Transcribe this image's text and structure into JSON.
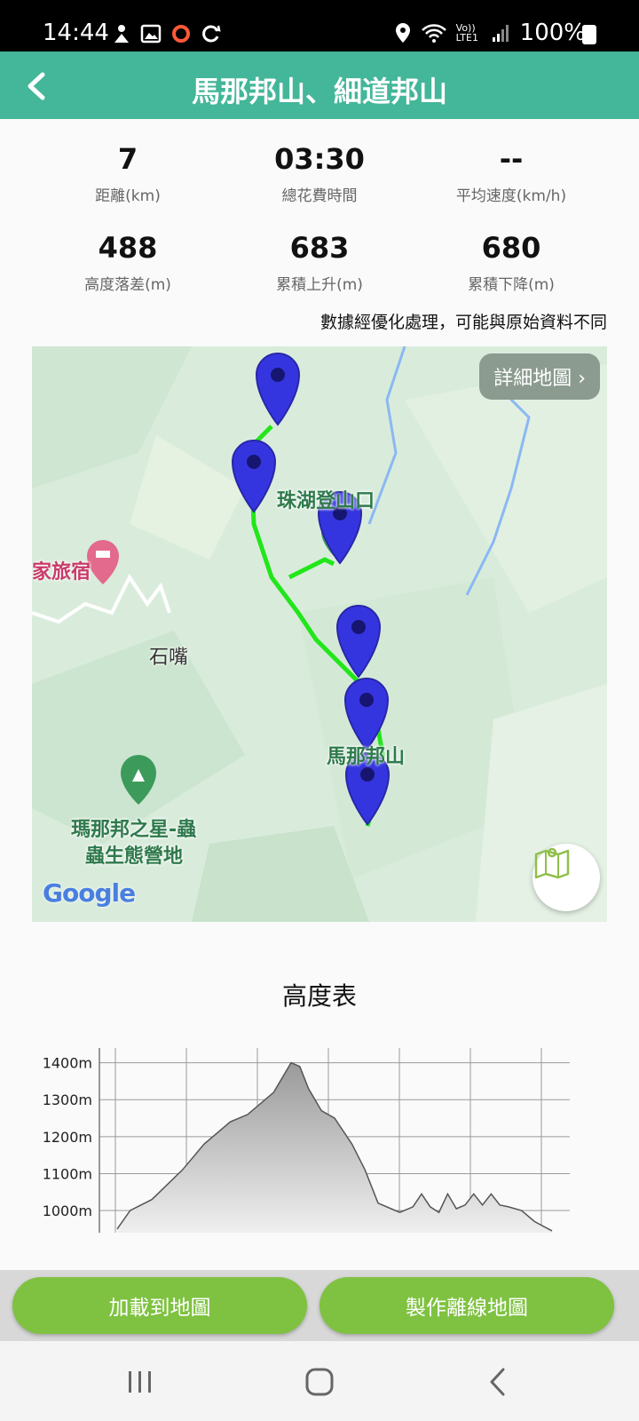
{
  "status_bar": {
    "time": "14:44",
    "network": "Vo)) LTE1",
    "battery": "100%"
  },
  "app_bar": {
    "title": "馬那邦山、細道邦山",
    "back_icon": "back-chevron-icon"
  },
  "stats": [
    {
      "value": "7",
      "label": "距離(km)"
    },
    {
      "value": "03:30",
      "label": "總花費時間"
    },
    {
      "value": "--",
      "label": "平均速度(km/h)"
    },
    {
      "value": "488",
      "label": "高度落差(m)"
    },
    {
      "value": "683",
      "label": "累積上升(m)"
    },
    {
      "value": "680",
      "label": "累積下降(m)"
    }
  ],
  "note": "數據經優化處理，可能與原始資料不同",
  "map": {
    "detail_button": "詳細地圖 ›",
    "labels": {
      "trailhead": "珠湖登山口",
      "inn": "家旅宿",
      "shizui": "石嘴",
      "peak": "馬那邦山",
      "camp_line1": "瑪那邦之星-蟲",
      "camp_line2": "蟲生態營地"
    },
    "attribution": "Google",
    "route_color": "#22e61a",
    "marker_color": "#3535e0"
  },
  "chart_title": "高度表",
  "chart_data": {
    "type": "area",
    "title": "高度表",
    "xlabel": "",
    "ylabel": "",
    "y_tick_labels": [
      "1400m",
      "1300m",
      "1200m",
      "1100m",
      "1000m"
    ],
    "y_ticks": [
      1400,
      1300,
      1200,
      1100,
      1000
    ],
    "ylim": [
      940,
      1440
    ],
    "grid": true,
    "series": [
      {
        "x": [
          0,
          0.03,
          0.08,
          0.15,
          0.2,
          0.26,
          0.3,
          0.36,
          0.4,
          0.42,
          0.44,
          0.47,
          0.5,
          0.54,
          0.57,
          0.6,
          0.63,
          0.65,
          0.68,
          0.7,
          0.72,
          0.74,
          0.76,
          0.78,
          0.8,
          0.82,
          0.84,
          0.86,
          0.88,
          0.9,
          0.93,
          0.96,
          1.0
        ],
        "y": [
          950,
          1000,
          1030,
          1110,
          1180,
          1240,
          1260,
          1320,
          1400,
          1390,
          1330,
          1270,
          1250,
          1180,
          1110,
          1020,
          1005,
          995,
          1010,
          1045,
          1010,
          995,
          1045,
          1005,
          1015,
          1045,
          1015,
          1045,
          1015,
          1010,
          1000,
          970,
          945
        ]
      }
    ]
  },
  "buttons": {
    "load_to_map": "加載到地圖",
    "make_offline_map": "製作離線地圖"
  },
  "nav_icons": [
    "recent-apps-icon",
    "home-icon",
    "back-icon"
  ]
}
